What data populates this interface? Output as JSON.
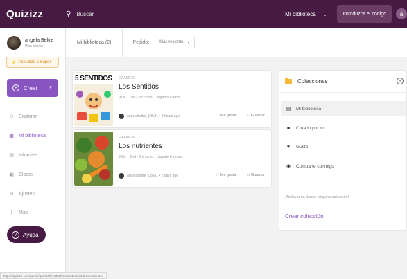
{
  "header": {
    "logo": "Quizizz",
    "search_placeholder": "Buscar",
    "library_label": "Mi biblioteca",
    "join_code_button": "Introduzca el código",
    "avatar_initial": "a"
  },
  "sidebar": {
    "user_name": "angela Beltre",
    "user_plan": "Plan básico",
    "upgrade_label": "Actualiza a Super",
    "create_label": "Crear",
    "items": [
      {
        "label": "Explorar",
        "icon": "compass-icon"
      },
      {
        "label": "Mi biblioteca",
        "icon": "library-icon"
      },
      {
        "label": "Informes",
        "icon": "reports-icon"
      },
      {
        "label": "Clases",
        "icon": "classes-icon"
      },
      {
        "label": "Ajustes",
        "icon": "gear-icon"
      },
      {
        "label": "Más",
        "icon": "more-icon"
      }
    ],
    "help_label": "Ayuda"
  },
  "filters": {
    "library_count": "Mi biblioteca (2)",
    "order_label": "Pedido:",
    "order_value": "Más reciente"
  },
  "quizzes": [
    {
      "type": "EXAMEN",
      "title": "Los Sentidos",
      "thumb_text": "5 SENTIDOS",
      "questions": "9 Qs",
      "grade": "1st - 3rd curso",
      "played": "Jugado 0 veces",
      "author": "angelabeltre_1j8k81 • 3 hours ago",
      "like_label": "Me gusta",
      "save_label": "Guardar"
    },
    {
      "type": "EXAMEN",
      "title": "Los nutrientes",
      "questions": "9 Qs",
      "grade": "2nd - 3rd curso",
      "played": "Jugado 0 veces",
      "author": "angelabeltre_1j8k81 • 2 days ago",
      "like_label": "Me gusta",
      "save_label": "Guardar"
    }
  ],
  "collections": {
    "title": "Colecciones",
    "items": [
      {
        "label": "Mi biblioteca",
        "icon": "folder-open-icon"
      },
      {
        "label": "Creado por mí",
        "icon": "folder-icon"
      },
      {
        "label": "Gusto",
        "icon": "heart-icon"
      },
      {
        "label": "Comparte conmigo",
        "icon": "globe-icon"
      }
    ],
    "empty_text": "¡Todavía no tienes ninguna colección!",
    "create_label": "Crear colección"
  },
  "status_url": "https://quizizz.com/admin/quiz/60f07c333f23e0021c01a1d/los-nutrientes",
  "colors": {
    "topbar": "#461a42",
    "accent": "#8854c0",
    "upgrade": "#d48b1f"
  }
}
